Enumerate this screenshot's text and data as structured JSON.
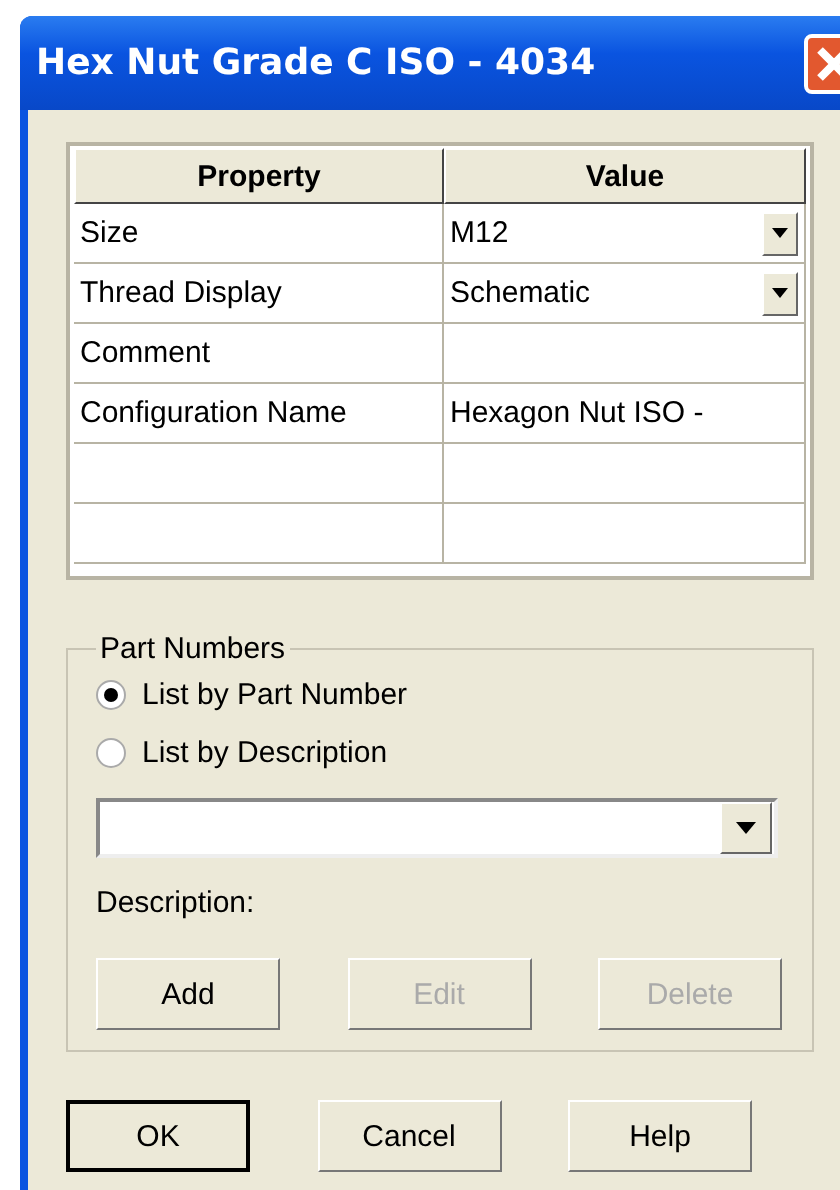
{
  "window": {
    "title": "Hex Nut Grade C ISO - 4034"
  },
  "table": {
    "columns": [
      "Property",
      "Value"
    ],
    "rows": [
      {
        "property": "Size",
        "value": "M12",
        "kind": "dropdown"
      },
      {
        "property": "Thread Display",
        "value": "Schematic",
        "kind": "dropdown"
      },
      {
        "property": "Comment",
        "value": "",
        "kind": "text"
      },
      {
        "property": "Configuration Name",
        "value": "Hexagon Nut ISO -",
        "kind": "text"
      },
      {
        "property": "",
        "value": "",
        "kind": "text"
      },
      {
        "property": "",
        "value": "",
        "kind": "text"
      }
    ]
  },
  "part_numbers": {
    "title": "Part Numbers",
    "options": [
      {
        "label": "List by Part Number",
        "selected": true
      },
      {
        "label": "List by Description",
        "selected": false
      }
    ],
    "description_label": "Description:",
    "buttons": [
      {
        "label": "Add",
        "disabled": false
      },
      {
        "label": "Edit",
        "disabled": true
      },
      {
        "label": "Delete",
        "disabled": true
      }
    ]
  },
  "buttons": [
    {
      "label": "OK",
      "default": true
    },
    {
      "label": "Cancel",
      "default": false
    },
    {
      "label": "Help",
      "default": false
    }
  ]
}
